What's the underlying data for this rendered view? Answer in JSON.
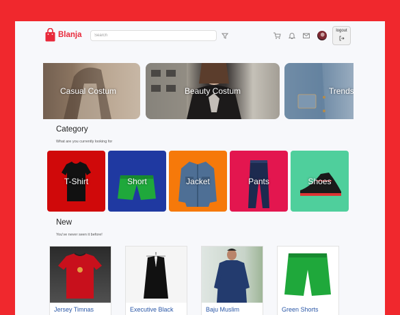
{
  "header": {
    "brand": "Blanja",
    "search_placeholder": "Search",
    "logout_label": "logout",
    "icons": [
      "cart-icon",
      "bell-icon",
      "mail-icon",
      "avatar"
    ]
  },
  "hero": {
    "slides": [
      {
        "title": "Casual Costum"
      },
      {
        "title": "Beauty Costum"
      },
      {
        "title": "Trends In"
      }
    ]
  },
  "category": {
    "title": "Category",
    "subtitle": "What are you currently looking for",
    "items": [
      {
        "label": "T-Shirt",
        "color": "#d0090a"
      },
      {
        "label": "Short",
        "color": "#1f39a1"
      },
      {
        "label": "Jacket",
        "color": "#f6790a"
      },
      {
        "label": "Pants",
        "color": "#e3164f"
      },
      {
        "label": "Shoes",
        "color": "#4fcf9c"
      }
    ]
  },
  "new": {
    "title": "New",
    "subtitle": "You've never seen it before!",
    "products": [
      {
        "name": "Jersey Timnas"
      },
      {
        "name": "Executive Black"
      },
      {
        "name": "Baju Muslim"
      },
      {
        "name": "Green Shorts"
      }
    ]
  },
  "colors": {
    "brand": "#e8293a",
    "frame": "#f0282d",
    "link": "#2a57a7"
  }
}
